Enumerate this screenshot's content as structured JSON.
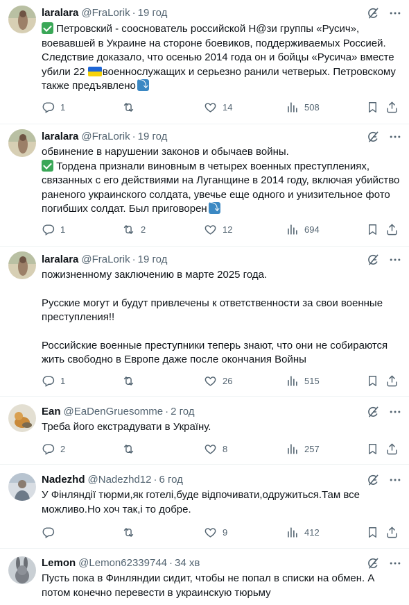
{
  "posts": [
    {
      "name": "laralara",
      "handle": "@FraLorik",
      "dot": "·",
      "time": "19 год",
      "lines": [
        "Петровский - сооснователь российской Н@зи группы «Русич»,",
        "воевавшей в Украине на стороне боевиков, поддерживаемых Россией.",
        "Следствие доказало, что осенью 2014 года он и бойцы «Русича» вместе",
        "убили 22 ",
        "военнослужащих и серьезно ранили четверых. Петровскому",
        "также предъявлено"
      ],
      "reply_count": "1",
      "retweet_count": "",
      "like_count": "14",
      "view_count": "508"
    },
    {
      "name": "laralara",
      "handle": "@FraLorik",
      "dot": "·",
      "time": "19 год",
      "lines": [
        "обвинение в нарушении законов и обычаев войны.",
        "Тордена признали виновным в четырех военных преступлениях,",
        "связанных с его действиями на Луганщине в 2014 году, включая убийство",
        "раненого украинского солдата, увечье еще одного и унизительное фото",
        "погибших солдат. Был приговорен"
      ],
      "reply_count": "1",
      "retweet_count": "2",
      "like_count": "12",
      "view_count": "694"
    },
    {
      "name": "laralara",
      "handle": "@FraLorik",
      "dot": "·",
      "time": "19 год",
      "lines": [
        "пожизненному заключению в марте 2025 года.",
        "Русские могут и будут привлечены к ответственности за свои военные",
        "преступления!!",
        "Российские военные преступники теперь знают, что они не собираются",
        "жить свободно в Европе даже после окончания Войны"
      ],
      "reply_count": "1",
      "retweet_count": "",
      "like_count": "26",
      "view_count": "515"
    },
    {
      "name": "Ean",
      "handle": "@EaDenGruesomme",
      "dot": "·",
      "time": "2 год",
      "lines": [
        "Треба його екстрадувати в Україну."
      ],
      "reply_count": "2",
      "retweet_count": "",
      "like_count": "8",
      "view_count": "257"
    },
    {
      "name": "Nadezhd",
      "handle": "@Nadezhd12",
      "dot": "·",
      "time": "6 год",
      "lines": [
        "У Фінляндії тюрми,як готелі,буде відпочивати,одружиться.Там все",
        "можливо.Но хоч так,і то добре."
      ],
      "reply_count": "",
      "retweet_count": "",
      "like_count": "9",
      "view_count": "412"
    },
    {
      "name": "Lemon",
      "handle": "@Lemon62339744",
      "dot": "·",
      "time": "34 хв",
      "lines": [
        "Пусть пока в Финляндии сидит, чтобы не попал в списки на обмен. А",
        "потом конечно перевести в украинскую тюрьму"
      ]
    }
  ],
  "icons": {
    "grok": "grok-icon",
    "more": "more-icon",
    "reply": "reply-icon",
    "retweet": "retweet-icon",
    "like": "like-icon",
    "views": "views-icon",
    "bookmark": "bookmark-icon",
    "share": "share-icon"
  },
  "colors": {
    "text": "#0f1419",
    "muted": "#536471",
    "divider": "#eff3f4",
    "check_badge": "#3aa757",
    "arrow_badge": "#3b88c3"
  }
}
